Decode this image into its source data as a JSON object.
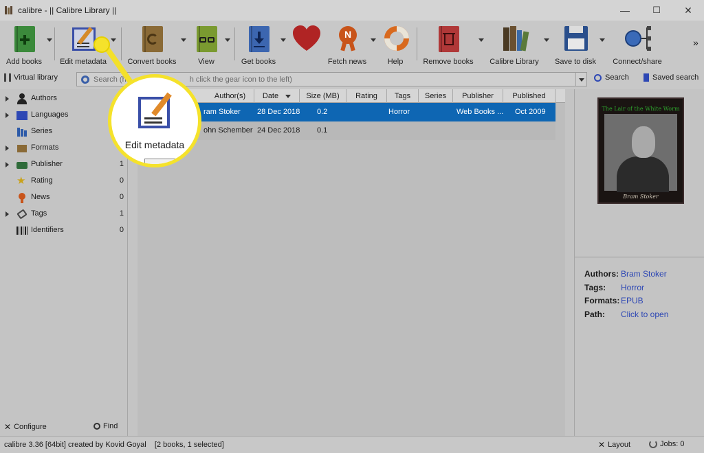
{
  "window": {
    "title": "calibre - || Calibre Library ||",
    "controls": {
      "minimize": "—",
      "maximize": "☐",
      "close": "✕"
    }
  },
  "toolbar": {
    "add_books": "Add books",
    "edit_metadata": "Edit metadata",
    "convert_books": "Convert books",
    "view": "View",
    "get_books": "Get books",
    "fetch_news": "Fetch news",
    "help": "Help",
    "remove_books": "Remove books",
    "calibre_library": "Calibre Library",
    "save_to_disk": "Save to disk",
    "connect_share": "Connect/share",
    "overflow": "»"
  },
  "searchbar": {
    "virtual_library": "Virtual library",
    "placeholder": "Search (h... ...h click the gear icon to the left)",
    "placeholder_visible_left": "Search (h",
    "placeholder_visible_right": "h click the gear icon to the left)",
    "search_button": "Search",
    "saved_search": "Saved search"
  },
  "tag_browser": {
    "items": [
      {
        "label": "Authors",
        "count": "",
        "expandable": true,
        "icon": "authors-icon"
      },
      {
        "label": "Languages",
        "count": "",
        "expandable": true,
        "icon": "languages-icon"
      },
      {
        "label": "Series",
        "count": "",
        "expandable": false,
        "icon": "series-icon"
      },
      {
        "label": "Formats",
        "count": "",
        "expandable": true,
        "icon": "formats-icon"
      },
      {
        "label": "Publisher",
        "count": "1",
        "expandable": true,
        "icon": "publisher-icon"
      },
      {
        "label": "Rating",
        "count": "0",
        "expandable": false,
        "icon": "rating-icon"
      },
      {
        "label": "News",
        "count": "0",
        "expandable": false,
        "icon": "news-icon"
      },
      {
        "label": "Tags",
        "count": "1",
        "expandable": true,
        "icon": "tags-icon"
      },
      {
        "label": "Identifiers",
        "count": "0",
        "expandable": false,
        "icon": "identifiers-icon"
      }
    ],
    "configure": "Configure",
    "find": "Find"
  },
  "book_table": {
    "columns": [
      "Author(s)",
      "Date",
      "Size (MB)",
      "Rating",
      "Tags",
      "Series",
      "Publisher",
      "Published"
    ],
    "rows": [
      {
        "author": "ram Stoker",
        "date": "28 Dec 2018",
        "size": "0.2",
        "rating": "",
        "tags": "Horror",
        "series": "",
        "publisher": "Web Books ...",
        "published": "Oct 2009",
        "selected": true
      },
      {
        "author": "ohn Schember",
        "date": "24 Dec 2018",
        "size": "0.1",
        "rating": "",
        "tags": "",
        "series": "",
        "publisher": "",
        "published": "",
        "selected": false
      }
    ]
  },
  "book_details": {
    "cover_title": "The Lair of the White Worm",
    "cover_author": "Bram Stoker",
    "authors_label": "Authors:",
    "authors_value": "Bram Stoker",
    "tags_label": "Tags:",
    "tags_value": "Horror",
    "formats_label": "Formats:",
    "formats_value": "EPUB",
    "path_label": "Path:",
    "path_value": "Click to open"
  },
  "statusbar": {
    "version": "calibre 3.36 [64bit] created by Kovid Goyal",
    "selection": "[2 books, 1 selected]",
    "layout": "Layout",
    "jobs": "Jobs: 0"
  },
  "callout": {
    "label": "Edit metadata"
  },
  "colors": {
    "selection": "#0e66b3",
    "highlight": "#f5e22b",
    "link": "#2d47b4"
  }
}
